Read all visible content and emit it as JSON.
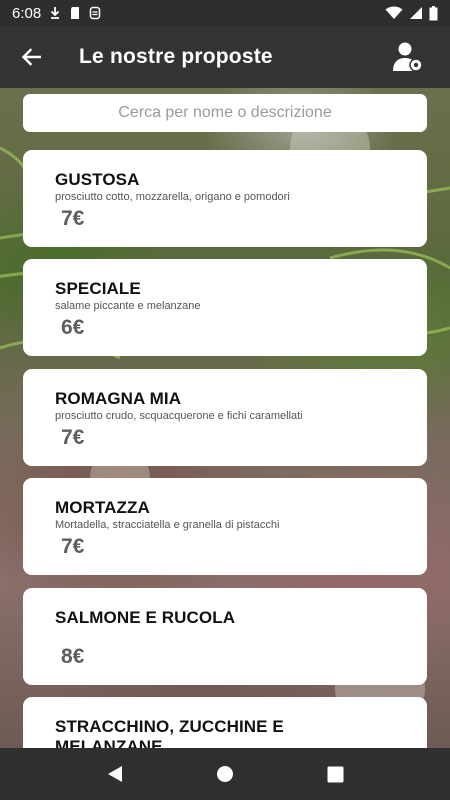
{
  "status_bar": {
    "time": "6:08"
  },
  "app_bar": {
    "title": "Le nostre proposte"
  },
  "search": {
    "placeholder": "Cerca per nome o descrizione"
  },
  "menu_items": [
    {
      "name": "GUSTOSA",
      "description": "prosciutto cotto, mozzarella, origano e pomodori",
      "price": "7€"
    },
    {
      "name": "SPECIALE",
      "description": "salame piccante e melanzane",
      "price": "6€"
    },
    {
      "name": "ROMAGNA MIA",
      "description": "prosciutto crudo, scquacquerone e fichi caramellati",
      "price": "7€"
    },
    {
      "name": "MORTAZZA",
      "description": "Mortadella, stracciatella e granella di pistacchi",
      "price": "7€"
    },
    {
      "name": "SALMONE E RUCOLA",
      "description": "",
      "price": "8€"
    },
    {
      "name": "STRACCHINO, ZUCCHINE E MELANZANE",
      "description": "",
      "price": ""
    }
  ],
  "icons": {
    "back": "arrow-left-icon",
    "profile": "user-gear-icon",
    "nav_back": "triangle-back-icon",
    "nav_home": "circle-home-icon",
    "nav_recents": "square-recents-icon"
  }
}
